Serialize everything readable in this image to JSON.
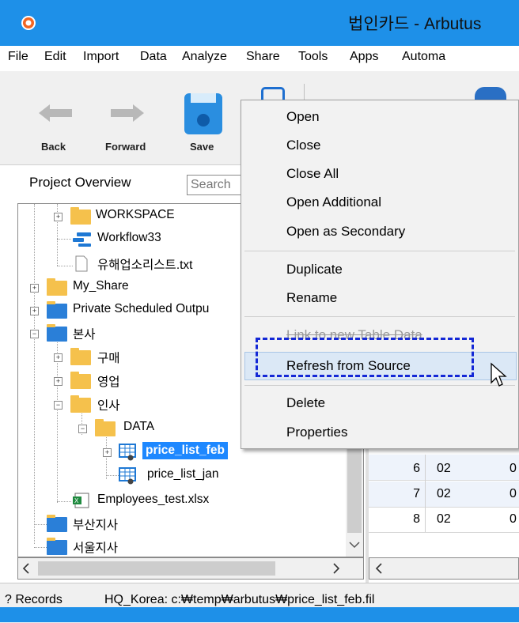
{
  "window": {
    "title": "법인카드 - Arbutus"
  },
  "menu": [
    "File",
    "Edit",
    "Import",
    "Data",
    "Analyze",
    "Share",
    "Tools",
    "Apps",
    "Automa"
  ],
  "toolbar": {
    "back": "Back",
    "forward": "Forward",
    "save": "Save"
  },
  "project_overview": {
    "title": "Project Overview",
    "search_placeholder": "Search"
  },
  "tree": [
    "WORKSPACE",
    "Workflow33",
    "유해업소리스트.txt",
    "My_Share",
    "Private Scheduled Outpu",
    "본사",
    "구매",
    "영업",
    "인사",
    "DATA",
    "price_list_feb",
    "price_list_jan",
    "Employees_test.xlsx",
    "부산지사",
    "서울지사"
  ],
  "context_menu": {
    "items": [
      "Open",
      "Close",
      "Close All",
      "Open Additional",
      "Open as Secondary",
      "Duplicate",
      "Rename",
      "Link to new Table Data",
      "Refresh from Source",
      "Delete",
      "Properties"
    ]
  },
  "grid": {
    "rows": [
      {
        "num": "6",
        "c1": "02",
        "c2": "0"
      },
      {
        "num": "7",
        "c1": "02",
        "c2": "0"
      },
      {
        "num": "8",
        "c1": "02",
        "c2": "0"
      }
    ]
  },
  "status": {
    "records": "? Records",
    "path": "HQ_Korea: c:₩temp₩arbutus₩price_list_feb.fil"
  },
  "colors": {
    "title_bar": "#1e90e8",
    "selection": "#1e88ff",
    "highlight_dash": "#1428d6"
  }
}
